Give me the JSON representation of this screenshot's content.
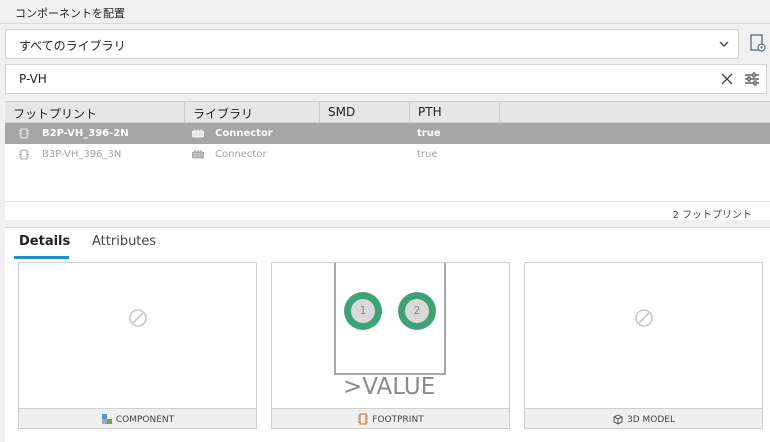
{
  "window": {
    "title": "コンポーネントを配置"
  },
  "library_select": {
    "value": "すべてのライブラリ",
    "chevron_icon": "chevron-down-icon",
    "manage_icon": "library-settings-icon"
  },
  "search": {
    "value": "P-VH",
    "clear_icon": "close-icon",
    "filter_icon": "filter-sliders-icon"
  },
  "table": {
    "headers": [
      "フットプリント",
      "ライブラリ",
      "SMD",
      "PTH"
    ],
    "rows": [
      {
        "footprint": "B2P-VH_396-2N",
        "library": "Connector",
        "smd": "",
        "pth": "true",
        "selected": true
      },
      {
        "footprint": "B3P-VH_396_3N",
        "library": "Connector",
        "smd": "",
        "pth": "true",
        "selected": false
      }
    ],
    "count_label": "2 フットプリント"
  },
  "tabs": [
    {
      "label": "Details",
      "active": true
    },
    {
      "label": "Attributes",
      "active": false
    }
  ],
  "previews": {
    "component": {
      "label": "COMPONENT",
      "icon": "component-icon",
      "placeholder_icon": "no-image-icon"
    },
    "footprint": {
      "label": "FOOTPRINT",
      "icon": "footprint-icon",
      "pads": [
        "1",
        "2"
      ],
      "value_text": ">VALUE"
    },
    "model": {
      "label": "3D MODEL",
      "icon": "cube-icon",
      "placeholder_icon": "no-image-icon"
    }
  },
  "colors": {
    "accent": "#1f93c9",
    "pad_green": "#3fa277",
    "selected_row": "#a6a6a6"
  }
}
